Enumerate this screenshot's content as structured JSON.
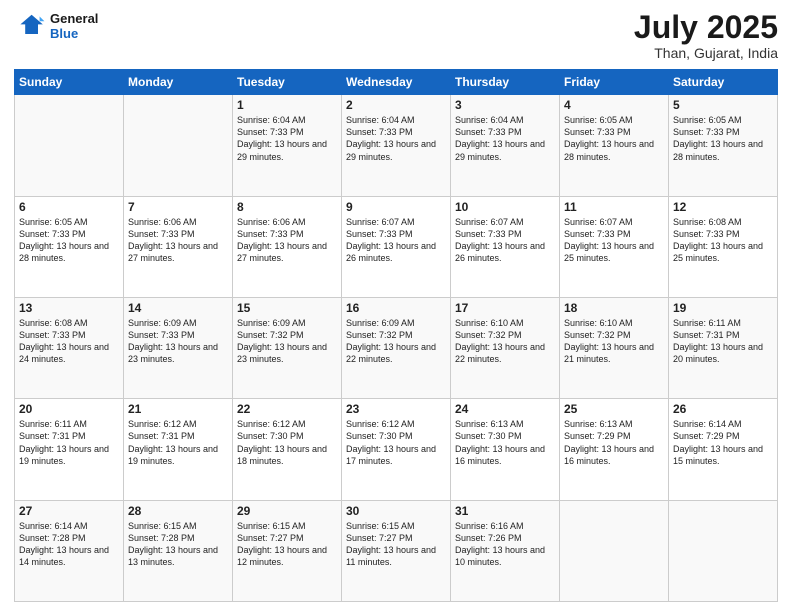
{
  "header": {
    "logo_line1": "General",
    "logo_line2": "Blue",
    "month_year": "July 2025",
    "location": "Than, Gujarat, India"
  },
  "weekdays": [
    "Sunday",
    "Monday",
    "Tuesday",
    "Wednesday",
    "Thursday",
    "Friday",
    "Saturday"
  ],
  "weeks": [
    [
      {
        "day": "",
        "info": ""
      },
      {
        "day": "",
        "info": ""
      },
      {
        "day": "1",
        "info": "Sunrise: 6:04 AM\nSunset: 7:33 PM\nDaylight: 13 hours and 29 minutes."
      },
      {
        "day": "2",
        "info": "Sunrise: 6:04 AM\nSunset: 7:33 PM\nDaylight: 13 hours and 29 minutes."
      },
      {
        "day": "3",
        "info": "Sunrise: 6:04 AM\nSunset: 7:33 PM\nDaylight: 13 hours and 29 minutes."
      },
      {
        "day": "4",
        "info": "Sunrise: 6:05 AM\nSunset: 7:33 PM\nDaylight: 13 hours and 28 minutes."
      },
      {
        "day": "5",
        "info": "Sunrise: 6:05 AM\nSunset: 7:33 PM\nDaylight: 13 hours and 28 minutes."
      }
    ],
    [
      {
        "day": "6",
        "info": "Sunrise: 6:05 AM\nSunset: 7:33 PM\nDaylight: 13 hours and 28 minutes."
      },
      {
        "day": "7",
        "info": "Sunrise: 6:06 AM\nSunset: 7:33 PM\nDaylight: 13 hours and 27 minutes."
      },
      {
        "day": "8",
        "info": "Sunrise: 6:06 AM\nSunset: 7:33 PM\nDaylight: 13 hours and 27 minutes."
      },
      {
        "day": "9",
        "info": "Sunrise: 6:07 AM\nSunset: 7:33 PM\nDaylight: 13 hours and 26 minutes."
      },
      {
        "day": "10",
        "info": "Sunrise: 6:07 AM\nSunset: 7:33 PM\nDaylight: 13 hours and 26 minutes."
      },
      {
        "day": "11",
        "info": "Sunrise: 6:07 AM\nSunset: 7:33 PM\nDaylight: 13 hours and 25 minutes."
      },
      {
        "day": "12",
        "info": "Sunrise: 6:08 AM\nSunset: 7:33 PM\nDaylight: 13 hours and 25 minutes."
      }
    ],
    [
      {
        "day": "13",
        "info": "Sunrise: 6:08 AM\nSunset: 7:33 PM\nDaylight: 13 hours and 24 minutes."
      },
      {
        "day": "14",
        "info": "Sunrise: 6:09 AM\nSunset: 7:33 PM\nDaylight: 13 hours and 23 minutes."
      },
      {
        "day": "15",
        "info": "Sunrise: 6:09 AM\nSunset: 7:32 PM\nDaylight: 13 hours and 23 minutes."
      },
      {
        "day": "16",
        "info": "Sunrise: 6:09 AM\nSunset: 7:32 PM\nDaylight: 13 hours and 22 minutes."
      },
      {
        "day": "17",
        "info": "Sunrise: 6:10 AM\nSunset: 7:32 PM\nDaylight: 13 hours and 22 minutes."
      },
      {
        "day": "18",
        "info": "Sunrise: 6:10 AM\nSunset: 7:32 PM\nDaylight: 13 hours and 21 minutes."
      },
      {
        "day": "19",
        "info": "Sunrise: 6:11 AM\nSunset: 7:31 PM\nDaylight: 13 hours and 20 minutes."
      }
    ],
    [
      {
        "day": "20",
        "info": "Sunrise: 6:11 AM\nSunset: 7:31 PM\nDaylight: 13 hours and 19 minutes."
      },
      {
        "day": "21",
        "info": "Sunrise: 6:12 AM\nSunset: 7:31 PM\nDaylight: 13 hours and 19 minutes."
      },
      {
        "day": "22",
        "info": "Sunrise: 6:12 AM\nSunset: 7:30 PM\nDaylight: 13 hours and 18 minutes."
      },
      {
        "day": "23",
        "info": "Sunrise: 6:12 AM\nSunset: 7:30 PM\nDaylight: 13 hours and 17 minutes."
      },
      {
        "day": "24",
        "info": "Sunrise: 6:13 AM\nSunset: 7:30 PM\nDaylight: 13 hours and 16 minutes."
      },
      {
        "day": "25",
        "info": "Sunrise: 6:13 AM\nSunset: 7:29 PM\nDaylight: 13 hours and 16 minutes."
      },
      {
        "day": "26",
        "info": "Sunrise: 6:14 AM\nSunset: 7:29 PM\nDaylight: 13 hours and 15 minutes."
      }
    ],
    [
      {
        "day": "27",
        "info": "Sunrise: 6:14 AM\nSunset: 7:28 PM\nDaylight: 13 hours and 14 minutes."
      },
      {
        "day": "28",
        "info": "Sunrise: 6:15 AM\nSunset: 7:28 PM\nDaylight: 13 hours and 13 minutes."
      },
      {
        "day": "29",
        "info": "Sunrise: 6:15 AM\nSunset: 7:27 PM\nDaylight: 13 hours and 12 minutes."
      },
      {
        "day": "30",
        "info": "Sunrise: 6:15 AM\nSunset: 7:27 PM\nDaylight: 13 hours and 11 minutes."
      },
      {
        "day": "31",
        "info": "Sunrise: 6:16 AM\nSunset: 7:26 PM\nDaylight: 13 hours and 10 minutes."
      },
      {
        "day": "",
        "info": ""
      },
      {
        "day": "",
        "info": ""
      }
    ]
  ]
}
